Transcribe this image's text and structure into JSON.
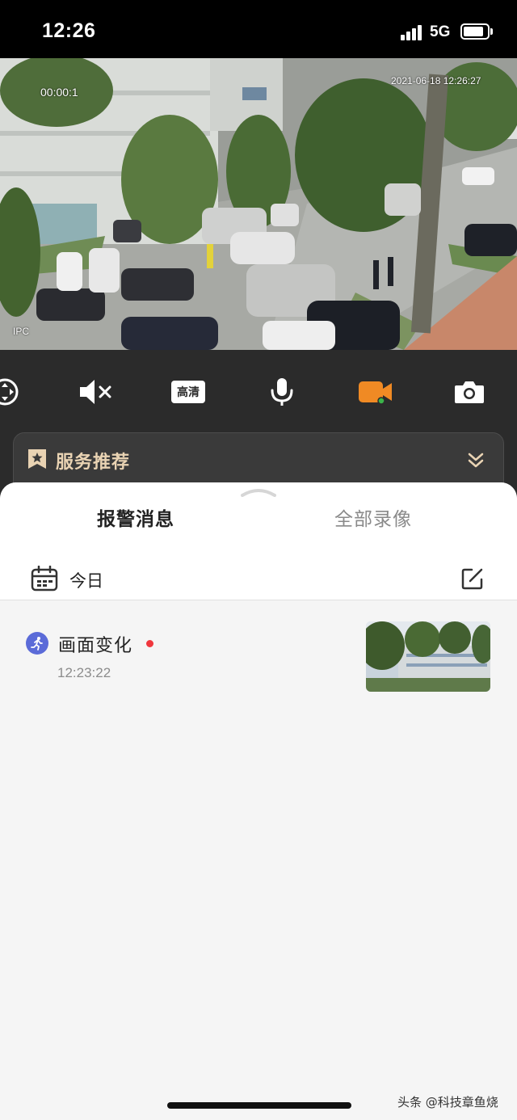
{
  "status_bar": {
    "time": "12:26",
    "network": "5G",
    "battery_level": 0.85
  },
  "video": {
    "timer": "00:00:1",
    "timestamp": "2021-06-18 12:26:27",
    "camera_label": "IPC"
  },
  "controls": {
    "hd_label": "高清",
    "items": [
      "pan-tilt-icon",
      "mute-icon",
      "hd-quality-icon",
      "microphone-icon",
      "record-icon",
      "camera-icon"
    ]
  },
  "service": {
    "title": "服务推荐"
  },
  "tabs": [
    {
      "label": "报警消息",
      "active": true
    },
    {
      "label": "全部录像",
      "active": false
    }
  ],
  "date_filter": {
    "label": "今日"
  },
  "alarms": [
    {
      "title": "画面变化",
      "time": "12:23:22",
      "unread": true
    }
  ],
  "watermark": "头条 @科技章鱼烧",
  "colors": {
    "accent_orange": "#f08a24",
    "service_gold": "#e9d3b3",
    "alarm_icon": "#5b6bd8",
    "unread_red": "#f0373d"
  }
}
